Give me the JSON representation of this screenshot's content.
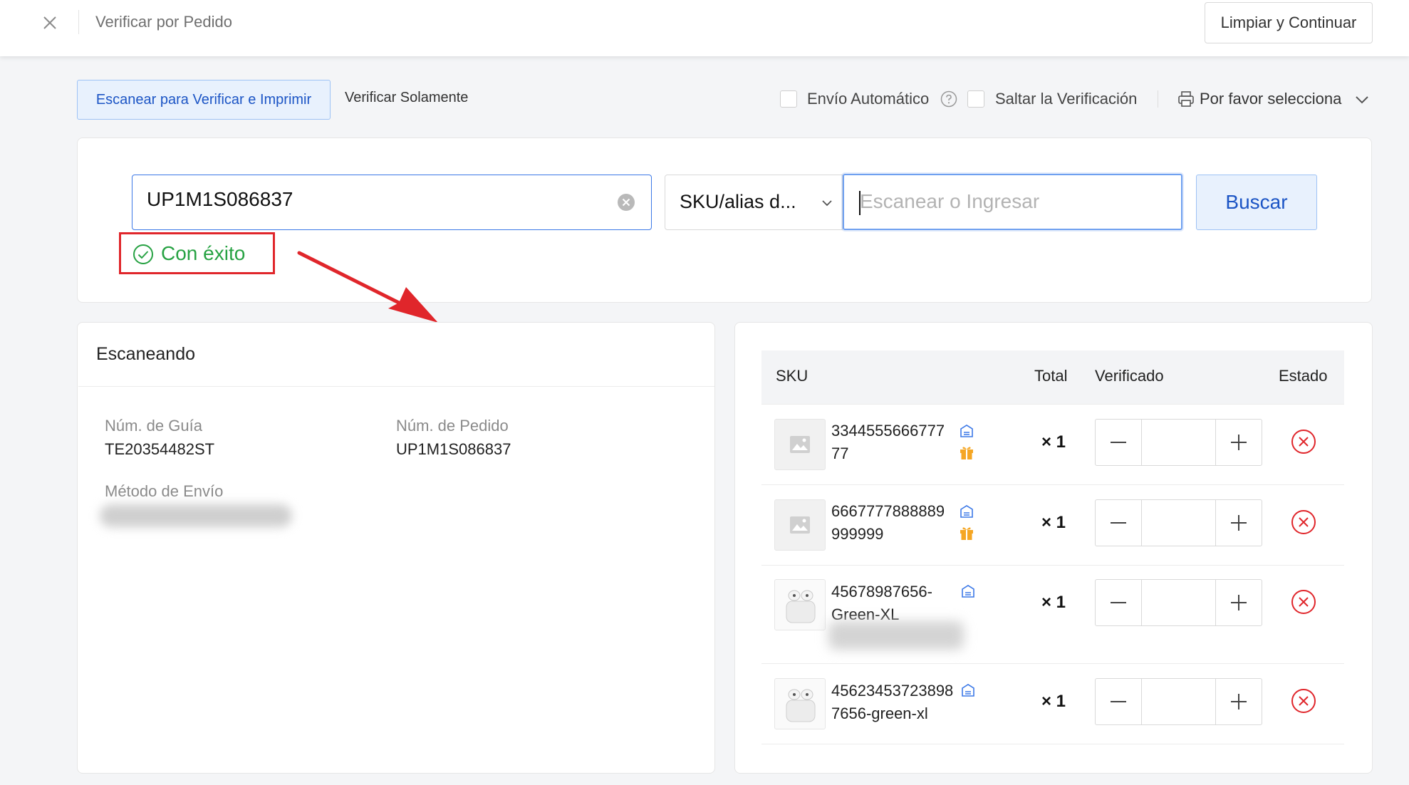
{
  "header": {
    "title": "Verificar por Pedido",
    "clear_continue_label": "Limpiar y Continuar"
  },
  "modes": {
    "scan_verify_print": "Escanear para Verificar e Imprimir",
    "verify_only": "Verificar Solamente"
  },
  "options": {
    "auto_ship_label": "Envío Automático",
    "auto_ship_checked": false,
    "skip_verify_label": "Saltar la Verificación",
    "skip_verify_checked": false,
    "printer_placeholder": "Por favor selecciona"
  },
  "search": {
    "order_value": "UP1M1S086837",
    "success_text": "Con éxito",
    "field_select": "SKU/alias d...",
    "scan_placeholder": "Escanear o Ingresar",
    "search_button": "Buscar"
  },
  "scanning": {
    "title": "Escaneando",
    "tracking_label": "Núm. de Guía",
    "tracking_value": "TE20354482ST",
    "order_label": "Núm. de Pedido",
    "order_value": "UP1M1S086837",
    "shipping_method_label": "Método de Envío"
  },
  "table": {
    "headers": [
      "SKU",
      "Total",
      "Verificado",
      "Estado"
    ],
    "rows": [
      {
        "sku_line1": "3344555666777",
        "sku_line2": "77",
        "qty": "× 1",
        "verified": "",
        "gift": true,
        "image": "placeholder"
      },
      {
        "sku_line1": "6667777888889",
        "sku_line2": "999999",
        "qty": "× 1",
        "verified": "",
        "gift": true,
        "image": "placeholder"
      },
      {
        "sku_line1": "45678987656-",
        "sku_line2": "Green-XL",
        "qty": "× 1",
        "verified": "",
        "gift": false,
        "image": "earbuds"
      },
      {
        "sku_line1": "45623453723898",
        "sku_line2": "7656-green-xl",
        "qty": "× 1",
        "verified": "",
        "gift": false,
        "image": "earbuds"
      }
    ]
  },
  "colors": {
    "accent": "#1c55c5",
    "success": "#27a243",
    "danger": "#e0262b",
    "warehouse_icon": "#3b78e7",
    "gift_icon": "#f5a623"
  }
}
